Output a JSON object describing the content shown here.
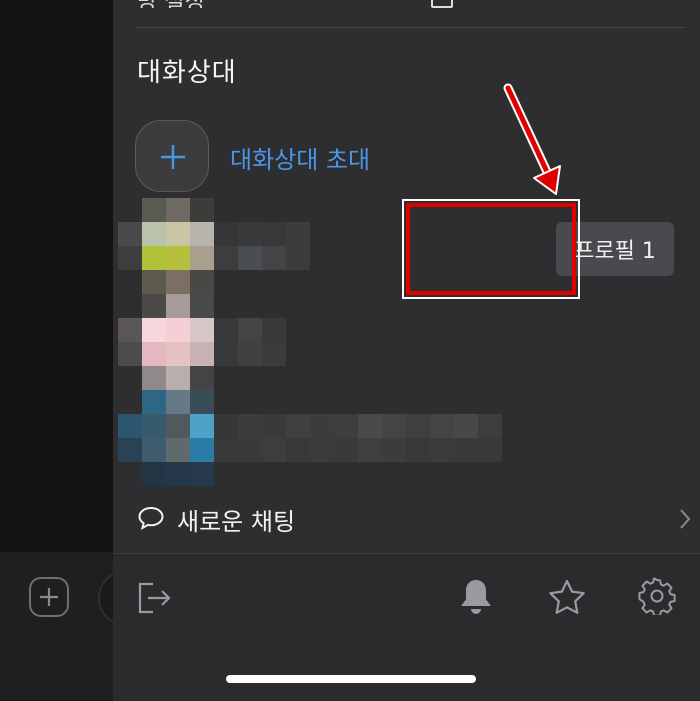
{
  "top": {
    "cut_text": "방 설정"
  },
  "section": {
    "title": "대화상대"
  },
  "invite": {
    "label": "대화상대 초대"
  },
  "profile_button": {
    "label": "프로필 1"
  },
  "new_chat": {
    "label": "새로운 채팅"
  },
  "bottom_bar": {
    "icons": [
      "exit-icon",
      "bell-icon",
      "star-icon",
      "gear-icon"
    ]
  },
  "colors": {
    "accent": "#4a96e6",
    "highlight": "#e00000",
    "panel": "#2e2e30"
  }
}
